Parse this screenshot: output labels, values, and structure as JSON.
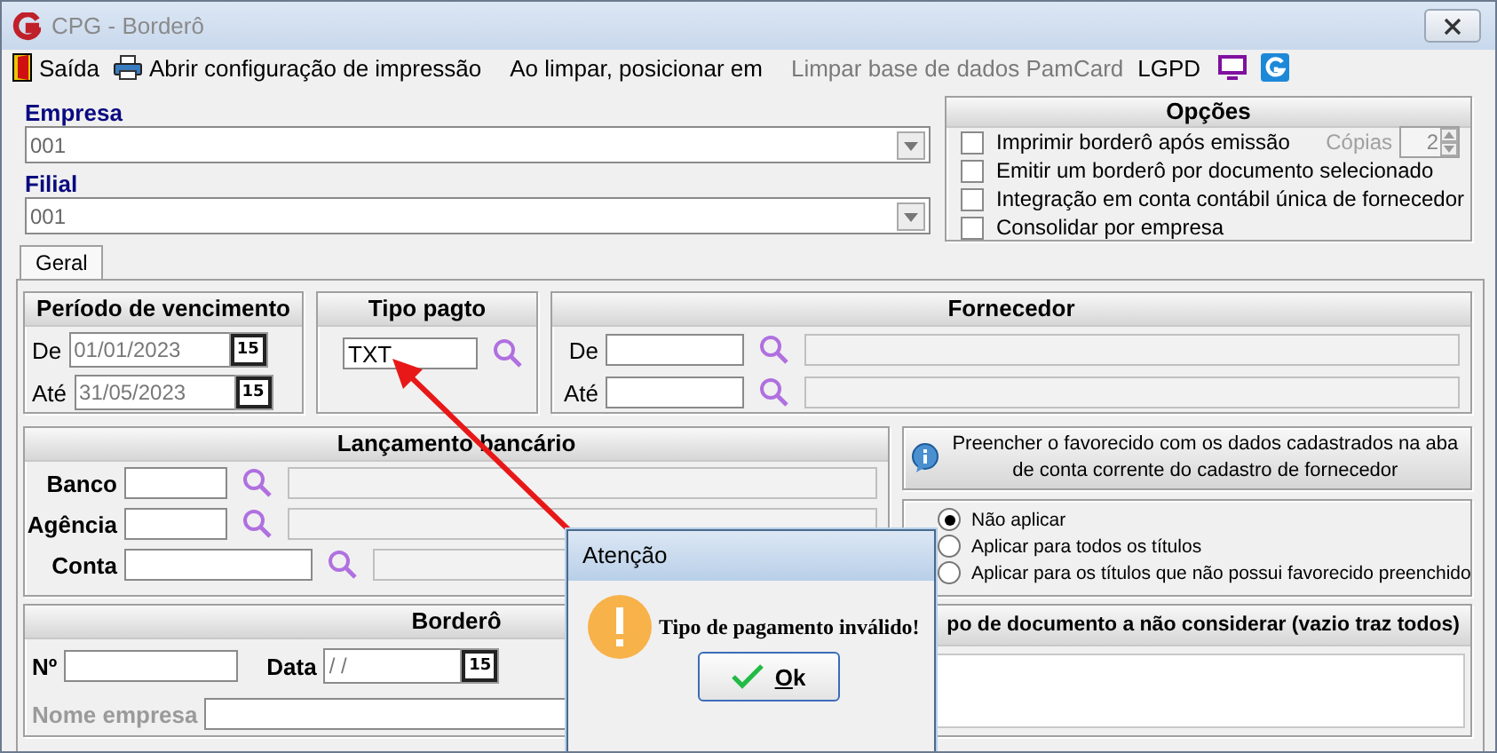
{
  "window": {
    "title": "CPG - Borderô"
  },
  "toolbar": [
    {
      "kind": "exit",
      "label": "Saída",
      "disabled": false
    },
    {
      "kind": "print",
      "label": "Abrir configuração de impressão",
      "disabled": false
    },
    {
      "kind": "text",
      "label": "Ao limpar, posicionar em",
      "disabled": false
    },
    {
      "kind": "text",
      "label": "Limpar base de dados PamCard",
      "disabled": true
    },
    {
      "kind": "text",
      "label": "LGPD",
      "disabled": false
    },
    {
      "kind": "monitor"
    },
    {
      "kind": "logo"
    }
  ],
  "empresa": {
    "label": "Empresa",
    "value": "001"
  },
  "filial": {
    "label": "Filial",
    "value": "001"
  },
  "options": {
    "title": "Opções",
    "copies": {
      "label": "Cópias",
      "value": "2"
    },
    "checkboxes": [
      {
        "label": "Imprimir borderô após emissão",
        "checked": false
      },
      {
        "label": "Emitir um borderô por documento selecionado",
        "checked": false
      },
      {
        "label": "Integração em conta contábil única de fornecedor",
        "checked": false
      },
      {
        "label": "Consolidar por empresa",
        "checked": false
      }
    ]
  },
  "tabs": [
    {
      "label": "Geral",
      "selected": true
    }
  ],
  "periodo": {
    "title": "Período de vencimento",
    "rows": [
      {
        "label": "De",
        "value": "01/01/2023",
        "button": "15"
      },
      {
        "label": "Até",
        "value": "31/05/2023",
        "button": "15"
      }
    ]
  },
  "tipo_pagto": {
    "title": "Tipo pagto",
    "value": "TXT"
  },
  "fornecedor": {
    "title": "Fornecedor",
    "rows": [
      {
        "label": "De"
      },
      {
        "label": "Até"
      }
    ]
  },
  "lancamento": {
    "title": "Lançamento bancário",
    "rows": [
      {
        "label": "Banco"
      },
      {
        "label": "Agência"
      },
      {
        "label": "Conta"
      }
    ]
  },
  "favorecido": {
    "note": "Preencher o favorecido com os dados cadastrados na aba de conta corrente do cadastro de fornecedor",
    "choices": [
      {
        "label": "Não aplicar",
        "selected": true
      },
      {
        "label": "Aplicar para todos os títulos",
        "selected": false
      },
      {
        "label": "Aplicar para os títulos que não possui favorecido preenchido",
        "selected": false
      }
    ]
  },
  "bordero": {
    "title": "Borderô",
    "number_label": "Nº",
    "date_label": "Data",
    "date_value": "/ /",
    "date_button": "15",
    "company_label": "Nome empresa",
    "company_disabled": true
  },
  "doc_types": {
    "title": "po de documento a não considerar (vazio traz todos)"
  },
  "dialog": {
    "title": "Atenção",
    "message": "Tipo de pagamento inválido!",
    "button": "Ok"
  }
}
